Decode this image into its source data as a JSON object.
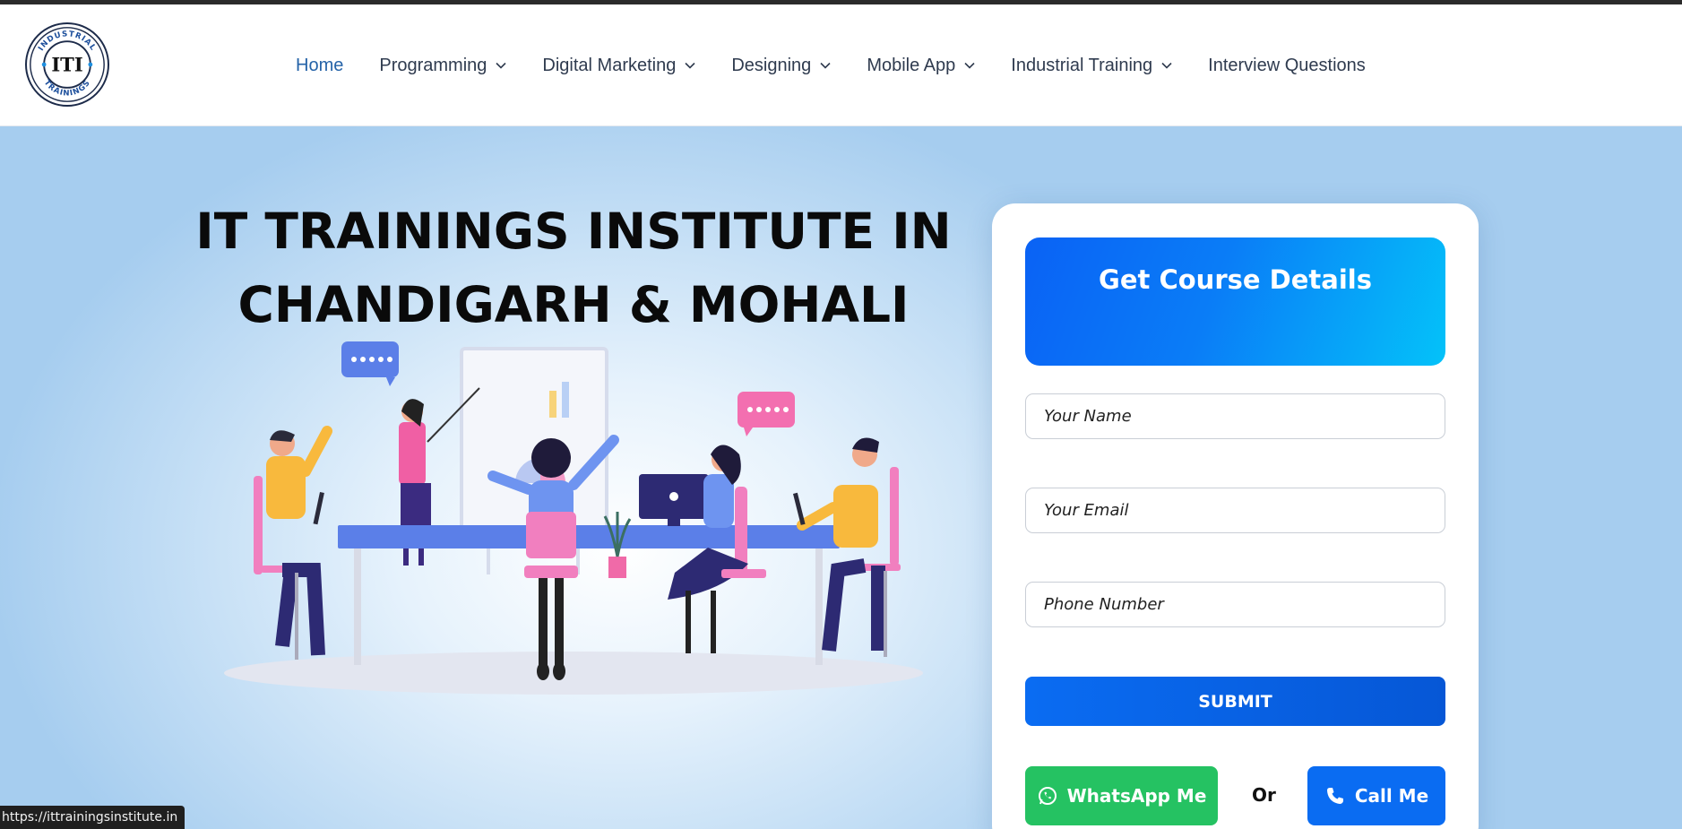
{
  "logo": {
    "text_top": "INDUSTRIAL",
    "text_bottom": "TRAININGS",
    "monogram": "ITI"
  },
  "nav": {
    "items": [
      {
        "label": "Home",
        "active": true,
        "has_dropdown": false
      },
      {
        "label": "Programming",
        "active": false,
        "has_dropdown": true
      },
      {
        "label": "Digital Marketing",
        "active": false,
        "has_dropdown": true
      },
      {
        "label": "Designing",
        "active": false,
        "has_dropdown": true
      },
      {
        "label": "Mobile App",
        "active": false,
        "has_dropdown": true
      },
      {
        "label": "Industrial Training",
        "active": false,
        "has_dropdown": true
      },
      {
        "label": "Interview Questions",
        "active": false,
        "has_dropdown": false
      }
    ]
  },
  "hero": {
    "title_line1": "IT TRAININGS INSTITUTE IN",
    "title_line2": "CHANDIGARH & MOHALI"
  },
  "form": {
    "heading": "Get Course Details",
    "name_placeholder": "Your Name",
    "email_placeholder": "Your Email",
    "phone_placeholder": "Phone Number",
    "submit_label": "SUBMIT",
    "whatsapp_label": "WhatsApp Me",
    "or_label": "Or",
    "call_label": "Call Me"
  },
  "status_bar": {
    "url": "https://ittrainingsinstitute.in"
  },
  "colors": {
    "nav_active": "#2563a8",
    "form_gradient_start": "#0a62f5",
    "form_gradient_end": "#04c2f9",
    "whatsapp_green": "#25c262",
    "call_blue": "#0a6cf2"
  },
  "icons": {
    "nav_dropdown": "chevron-down-icon",
    "whatsapp": "whatsapp-icon",
    "call": "phone-icon"
  }
}
